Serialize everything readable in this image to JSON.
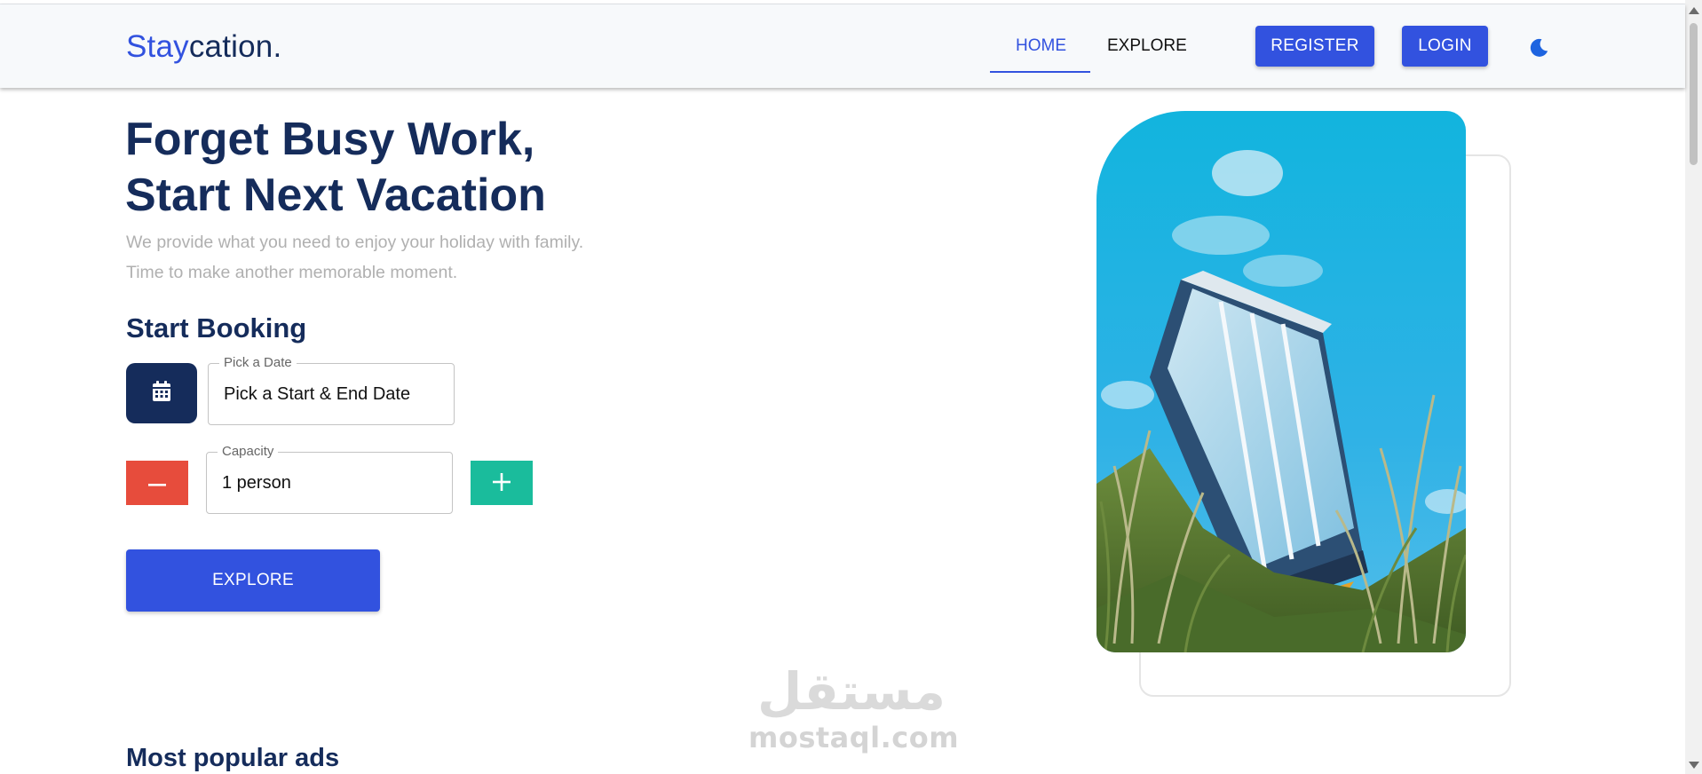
{
  "header": {
    "logo_accent": "Stay",
    "logo_rest": "cation.",
    "nav": {
      "home": "HOME",
      "explore": "EXPLORE"
    },
    "register_label": "REGISTER",
    "login_label": "LOGIN",
    "theme_icon": "moon-icon"
  },
  "hero": {
    "title_line1": "Forget Busy Work,",
    "title_line2": "Start Next Vacation",
    "subtitle_line1": "We provide what you need to enjoy your holiday with family.",
    "subtitle_line2": "Time to make another memorable moment."
  },
  "booking": {
    "title": "Start Booking",
    "calendar_icon": "calendar-icon",
    "date_label": "Pick a Date",
    "date_value": "Pick a Start & End Date",
    "capacity_label": "Capacity",
    "capacity_value": "1 person",
    "minus_icon": "minus-icon",
    "plus_icon": "plus-icon",
    "explore_label": "EXPLORE"
  },
  "watermark": {
    "arabic": "مستقل",
    "latin": "mostaql.com"
  },
  "sections": {
    "popular_title": "Most popular ads"
  },
  "colors": {
    "primary": "#3252df",
    "navy": "#152c5b",
    "danger": "#e74c3c",
    "success": "#1abc9c",
    "muted": "#b0b0b0"
  }
}
